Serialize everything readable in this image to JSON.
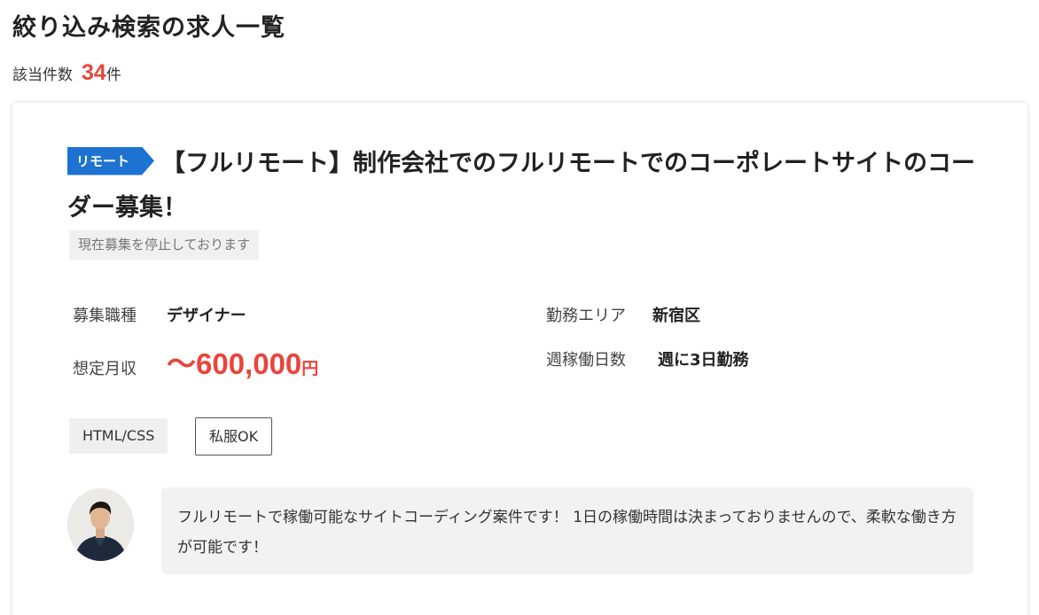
{
  "page": {
    "title": "絞り込み検索の求人一覧",
    "count_label": "該当件数",
    "count": "34",
    "count_unit": "件"
  },
  "job": {
    "badge": "リモート",
    "title": "【フルリモート】制作会社でのフルリモートでのコーポレートサイトのコーダー募集！",
    "status": "現在募集を停止しております",
    "specs": {
      "job_type_label": "募集職種",
      "job_type": "デザイナー",
      "area_label": "勤務エリア",
      "area": "新宿区",
      "salary_label": "想定月収",
      "salary": "〜600,000",
      "salary_unit": "円",
      "workdays_label": "週稼働日数",
      "workdays": "週に3日勤務"
    },
    "tags": [
      "HTML/CSS",
      "私服OK"
    ],
    "message": "フルリモートで稼働可能なサイトコーディング案件です！ 1日の稼働時間は決まっておりませんので、柔軟な働き方が可能です！"
  },
  "colors": {
    "accent_red": "#e8453c",
    "badge_blue": "#1e73d2"
  },
  "icons": {
    "avatar": "person-avatar"
  }
}
